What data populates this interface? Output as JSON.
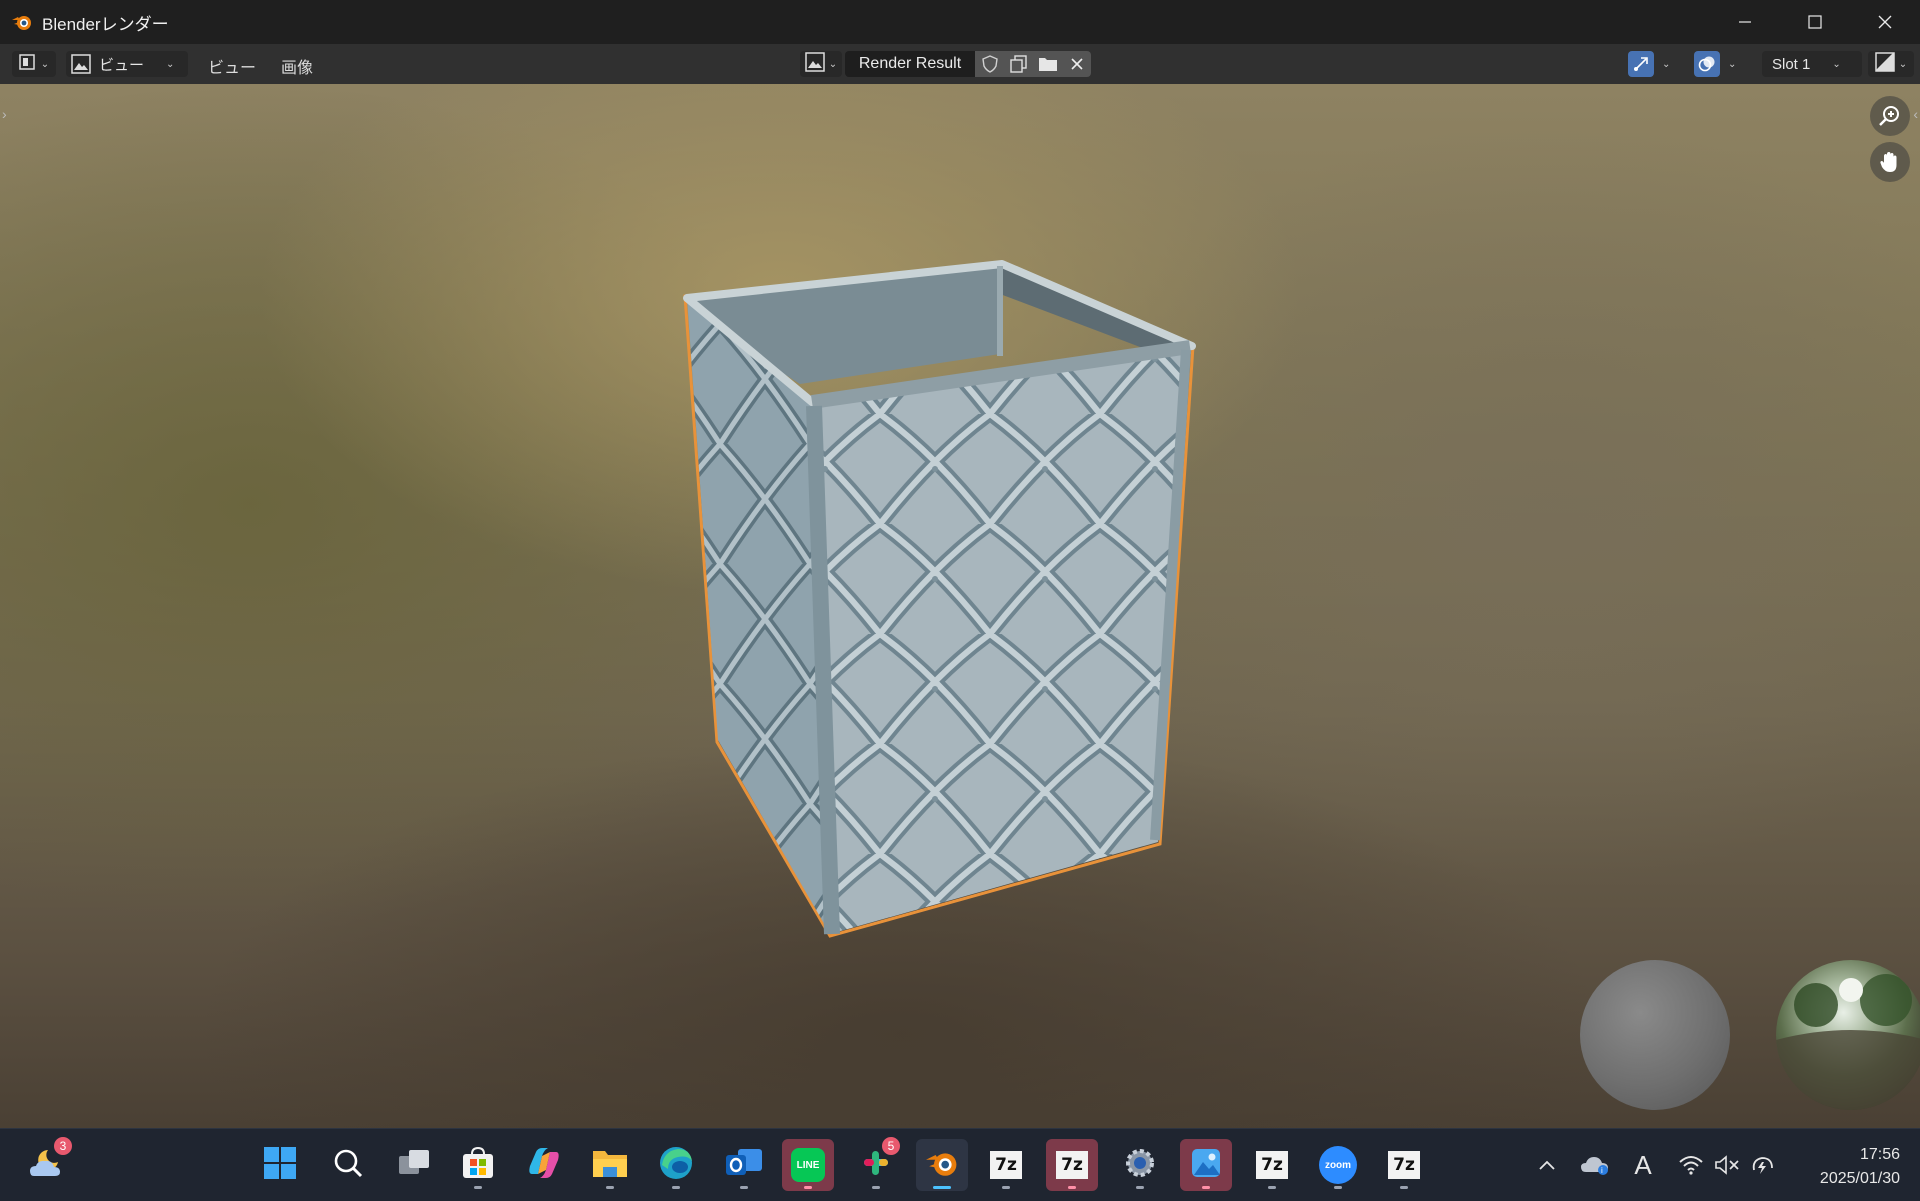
{
  "window": {
    "title": "Blenderレンダー",
    "controls": [
      "minimize-icon",
      "maximize-icon",
      "close-icon"
    ]
  },
  "header": {
    "editor_type_icon": "image-editor-icon",
    "view_mode": "ビュー",
    "menu_view": "ビュー",
    "menu_image": "画像",
    "image_name": "Render Result",
    "slot": "Slot 1"
  },
  "viewport": {
    "object": "decorative-metal-planter",
    "overlay_spheres": [
      "material-preview-sphere",
      "hdri-sphere"
    ]
  },
  "taskbar": {
    "weather_badge": "3",
    "slack_badge": "5",
    "line_label": "LINE",
    "zoom_label": "zoom",
    "sevenz_label": "7z",
    "time": "17:56",
    "date": "2025/01/30",
    "ime_indicator": "A"
  },
  "colors": {
    "blender_orange": "#e87d0d",
    "header_bg": "#303030",
    "taskbar_bg": "#1f2530",
    "active_blue": "#4772b3",
    "selection_outline": "#e8923a"
  }
}
